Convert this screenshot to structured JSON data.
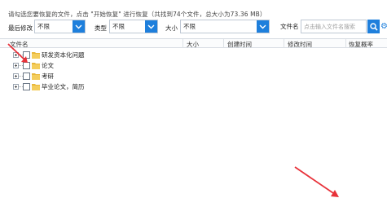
{
  "hint": "请勾选您要恢复的文件，点击 \"开始恢复\" 进行恢复（共找到74个文件，总大小为73.36 MB）",
  "filters": {
    "modified": {
      "label": "最后修改",
      "value": "不限"
    },
    "type": {
      "label": "类型",
      "value": "不限"
    },
    "size": {
      "label": "大小",
      "value": "不限"
    }
  },
  "search": {
    "label": "文件名",
    "placeholder": "点击输入文件名搜索"
  },
  "columns": [
    "文件名",
    "大小",
    "创建时间",
    "修改时间",
    "恢复概率"
  ],
  "tree": [
    {
      "label": "研发资本化问题"
    },
    {
      "label": "论文"
    },
    {
      "label": "考研"
    },
    {
      "label": "毕业论文，简历"
    }
  ],
  "colors": {
    "accent": "#1e7fdc",
    "folder": "#e8b73a",
    "arrow": "#e8323a"
  },
  "icons": [
    "chevron-down-icon",
    "search-icon",
    "gear-icon",
    "folder-icon",
    "expand-icon",
    "checkbox"
  ]
}
